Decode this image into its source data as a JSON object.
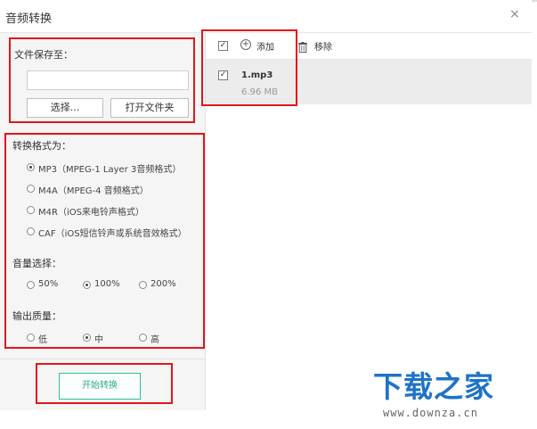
{
  "window": {
    "title": "音频转换",
    "close_glyph": "×"
  },
  "save": {
    "label": "文件保存至：",
    "path_value": "",
    "choose_button": "选择...",
    "open_folder_button": "打开文件夹"
  },
  "format": {
    "label": "转换格式为：",
    "options": [
      {
        "text": "MP3（MPEG-1 Layer 3音频格式）",
        "selected": true
      },
      {
        "text": "M4A（MPEG-4 音频格式）",
        "selected": false
      },
      {
        "text": "M4R（iOS来电铃声格式）",
        "selected": false
      },
      {
        "text": "CAF（iOS短信铃声或系统音效格式）",
        "selected": false
      }
    ]
  },
  "volume": {
    "label": "音量选择：",
    "options": [
      {
        "text": "50%",
        "selected": false
      },
      {
        "text": "100%",
        "selected": true
      },
      {
        "text": "200%",
        "selected": false
      }
    ]
  },
  "quality": {
    "label": "输出质量：",
    "options": [
      {
        "text": "低",
        "selected": false
      },
      {
        "text": "中",
        "selected": true
      },
      {
        "text": "高",
        "selected": false
      }
    ]
  },
  "start_button": "开始转换",
  "toolbar": {
    "select_all_checked": true,
    "add_label": "添加",
    "remove_label": "移除"
  },
  "files": [
    {
      "name": "1.mp3",
      "size": "6.96 MB",
      "checked": true
    }
  ],
  "watermark": {
    "logo_text": "下载之家",
    "site_text": "www.downza.cn"
  },
  "colors": {
    "highlight_red": "#e0161c",
    "accent_green": "#2fbf9c",
    "logo_blue": "#1e73c9"
  }
}
